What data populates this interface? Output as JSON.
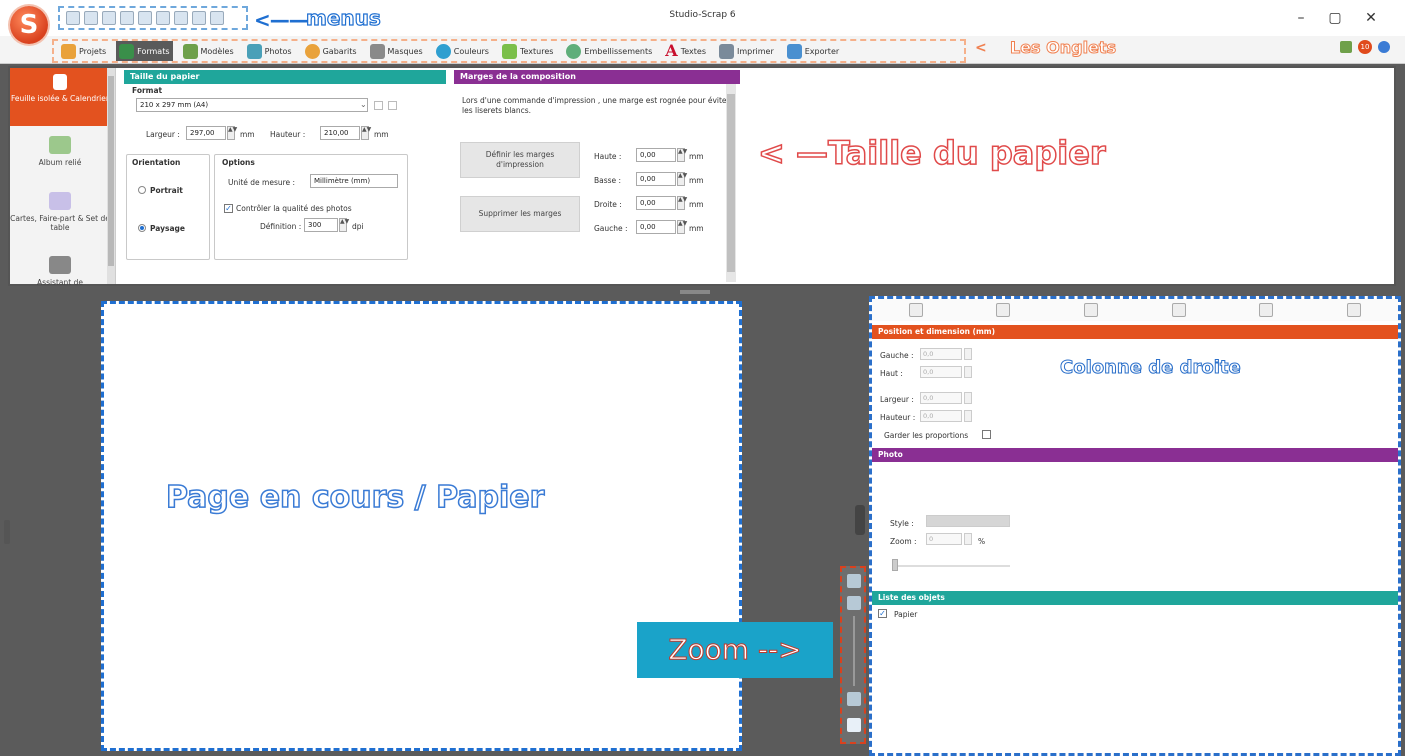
{
  "app": {
    "title": "Studio-Scrap 6",
    "logo_letter": "S"
  },
  "annotations": {
    "menus_arrow": "<——",
    "menus": "menus",
    "tabs_arrow": "<",
    "tabs": "Les Onglets",
    "paper_size_arrow": "< —",
    "paper_size": "Taille du papier",
    "page": "Page en cours / Papier",
    "right_column": "Colonne de droite",
    "zoom": "Zoom -->"
  },
  "window": {
    "minimize": "–",
    "maximize": "▢",
    "close": "✕"
  },
  "tabs": [
    {
      "label": "Projets",
      "color": "#e9a23b"
    },
    {
      "label": "Formats",
      "color": "#3a8f4a",
      "active": true
    },
    {
      "label": "Modèles",
      "color": "#6ea04a"
    },
    {
      "label": "Photos",
      "color": "#4aa0b8"
    },
    {
      "label": "Gabarits",
      "color": "#e9a23b"
    },
    {
      "label": "Masques",
      "color": "#8a8a8a"
    },
    {
      "label": "Couleurs",
      "color": "#2f9fd0"
    },
    {
      "label": "Textures",
      "color": "#7bbf4a"
    },
    {
      "label": "Embellissements",
      "color": "#5fae7a"
    },
    {
      "label": "Textes",
      "color": "#c8102e",
      "glyph": "A"
    },
    {
      "label": "Imprimer",
      "color": "#7a8a9a"
    },
    {
      "label": "Exporter",
      "color": "#4a90d0"
    }
  ],
  "notifications": {
    "count": "10"
  },
  "left_nav": [
    {
      "label": "Feuille isolée & Calendrier",
      "active": true
    },
    {
      "label": "Album relié"
    },
    {
      "label": "Cartes, Faire-part & Set de table"
    },
    {
      "label": "Assistant de"
    }
  ],
  "paper": {
    "header": "Taille du papier",
    "format_label": "Format",
    "format_value": "210 x 297 mm (A4)",
    "width_label": "Largeur :",
    "width_value": "297,00",
    "height_label": "Hauteur :",
    "height_value": "210,00",
    "unit_mm": "mm",
    "orientation_label": "Orientation",
    "portrait": "Portrait",
    "landscape": "Paysage",
    "options_label": "Options",
    "unit_label": "Unité de mesure :",
    "unit_value": "Millimètre (mm)",
    "quality_check": "Contrôler la qualité des photos",
    "definition_label": "Définition :",
    "definition_value": "300",
    "dpi": "dpi"
  },
  "margins": {
    "header": "Marges de la composition",
    "note": "Lors d'une commande d'impression , une marge est rognée pour éviter les liserets blancs.",
    "define_button": "Définir les marges d'impression",
    "remove_button": "Supprimer les marges",
    "top_label": "Haute :",
    "bottom_label": "Basse :",
    "right_label": "Droite :",
    "left_label": "Gauche :",
    "value": "0,00",
    "unit": "mm"
  },
  "position": {
    "header": "Position et dimension (mm)",
    "left_label": "Gauche :",
    "top_label": "Haut :",
    "width_label": "Largeur :",
    "height_label": "Hauteur :",
    "value": "0,0",
    "keep_ratio": "Garder les proportions"
  },
  "photo": {
    "header": "Photo",
    "style_label": "Style :",
    "zoom_label": "Zoom :",
    "zoom_value": "0",
    "zoom_unit": "%"
  },
  "objects": {
    "header": "Liste des objets",
    "items": [
      {
        "label": "Papier",
        "checked": true
      }
    ]
  },
  "colors": {
    "teal": "#1fa69b",
    "purple": "#8a2f93",
    "orange": "#e3521f",
    "blue_dash": "#1f6fd1"
  }
}
